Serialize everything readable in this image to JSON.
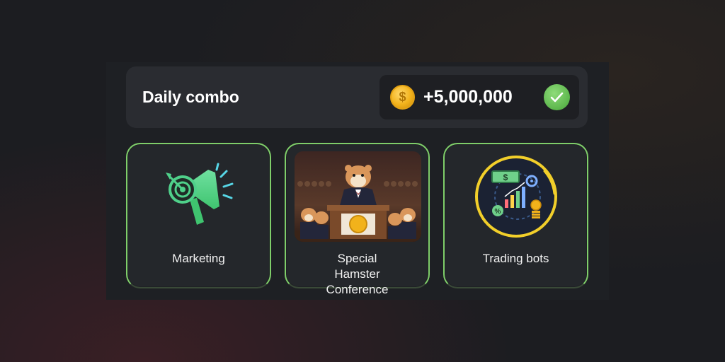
{
  "combo": {
    "title": "Daily combo",
    "reward": "+5,000,000",
    "coin_symbol": "$",
    "claimed": true
  },
  "cards": [
    {
      "label": "Marketing",
      "icon": "megaphone-target-icon"
    },
    {
      "label": "Special Hamster Conference",
      "icon": "hamster-conference-image"
    },
    {
      "label": "Trading bots",
      "icon": "trading-bots-icon"
    }
  ],
  "colors": {
    "accent_green": "#7fce6a",
    "coin_gold": "#f2b21b",
    "check_green": "#5cb64c",
    "card_bg": "#24272b",
    "panel_bg": "#2a2c31"
  }
}
